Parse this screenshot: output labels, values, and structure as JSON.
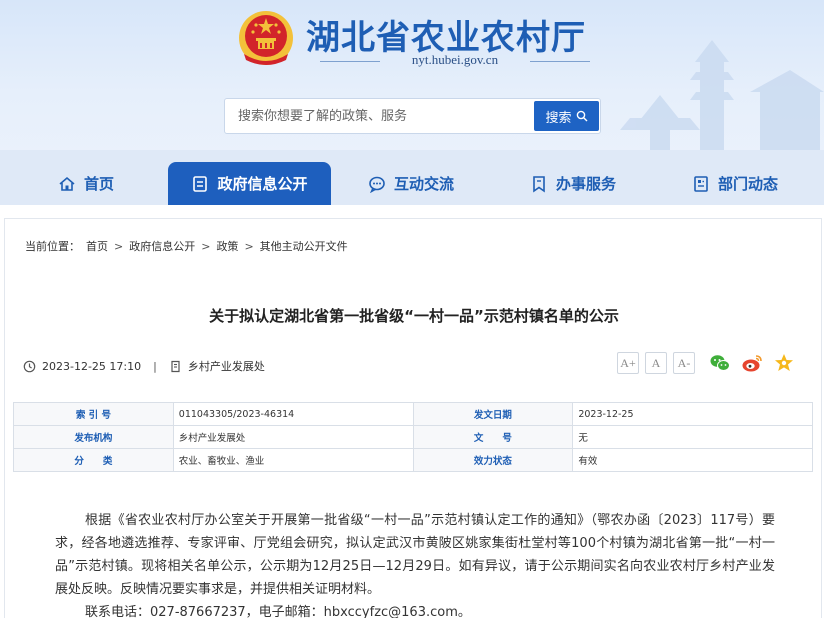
{
  "site": {
    "title": "湖北省农业农村厅",
    "domain": "nyt.hubei.gov.cn"
  },
  "search": {
    "placeholder": "搜索你想要了解的政策、服务",
    "button_label": "搜索"
  },
  "nav": [
    {
      "label": "首页",
      "icon": "home-icon"
    },
    {
      "label": "政府信息公开",
      "icon": "document-icon"
    },
    {
      "label": "互动交流",
      "icon": "chat-icon"
    },
    {
      "label": "办事服务",
      "icon": "bookmark-icon"
    },
    {
      "label": "部门动态",
      "icon": "news-icon"
    }
  ],
  "breadcrumb": {
    "prefix": "当前位置：",
    "items": [
      "首页",
      "政府信息公开",
      "政策",
      "其他主动公开文件"
    ]
  },
  "article": {
    "title": "关于拟认定湖北省第一批省级“一村一品”示范村镇名单的公示",
    "date": "2023-12-25 17:10",
    "divider": "|",
    "department": "乡村产业发展处",
    "font_buttons": [
      "A+",
      "A",
      "A-"
    ],
    "share_icons": [
      "wechat-icon",
      "weibo-icon",
      "favorite-icon"
    ]
  },
  "info_table": [
    [
      {
        "k": "索 引 号",
        "v": "011043305/2023-46314"
      },
      {
        "k": "发文日期",
        "v": "2023-12-25"
      }
    ],
    [
      {
        "k": "发布机构",
        "v": "乡村产业发展处"
      },
      {
        "k": "文　　号",
        "v": "无"
      }
    ],
    [
      {
        "k": "分　　类",
        "v": "农业、畜牧业、渔业"
      },
      {
        "k": "效力状态",
        "v": "有效"
      }
    ]
  ],
  "body": {
    "paragraph1": "根据《省农业农村厅办公室关于开展第一批省级“一村一品”示范村镇认定工作的通知》（鄂农办函〔2023〕117号）要求，经各地遴选推荐、专家评审、厅党组会研究，拟认定武汉市黄陂区姚家集街杜堂村等100个村镇为湖北省第一批“一村一品”示范村镇。现将相关名单公示，公示期为12月25日—12月29日。如有异议，请于公示期间实名向农业农村厅乡村产业发展处反映。反映情况要实事求是，并提供相关证明材料。",
    "paragraph2": "联系电话：027-87667237，电子邮箱：hbxccyfzc@163.com。"
  },
  "colors": {
    "brand_blue": "#1e5eb4",
    "nav_active": "#1e5fbe",
    "emblem_red": "#d2242a",
    "emblem_gold": "#f3c13a"
  }
}
